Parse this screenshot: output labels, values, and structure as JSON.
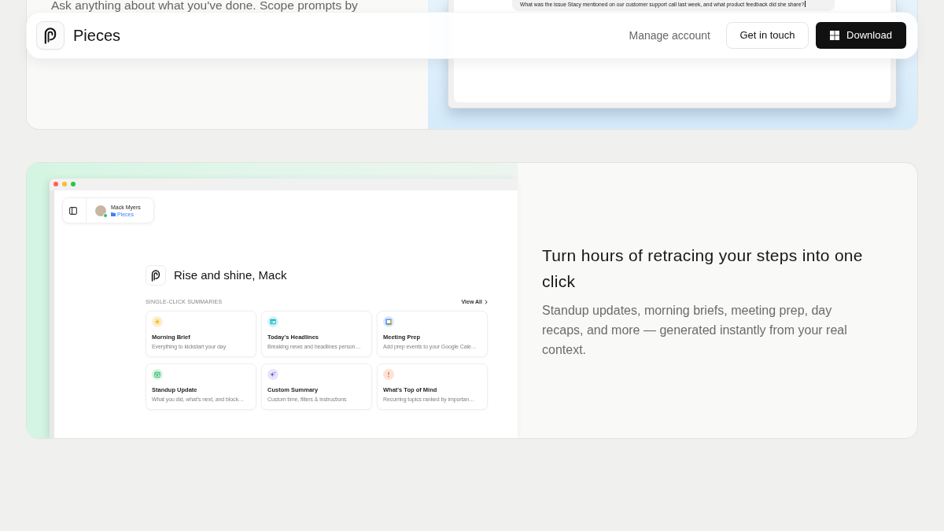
{
  "navbar": {
    "brand": "Pieces",
    "actions": [
      {
        "kind": "link",
        "label": "Manage account"
      },
      {
        "kind": "outline",
        "label": "Get in touch"
      },
      {
        "kind": "download",
        "label": "Download"
      }
    ]
  },
  "features": [
    {
      "kind": "prompt",
      "text": "Ask anything about what you've done. Scope prompts by",
      "preview": {
        "prompt": "What was the issue Stacy mentioned on our customer support call last week, and what product feedback did she share?"
      }
    },
    {
      "kind": "summaries",
      "title": "Turn hours of retracing your steps into one click",
      "text": "Standup updates, morning briefs, meeting prep, day recaps, and more — generated instantly from your real context.",
      "preview": {
        "user": {
          "name": "Mack Myers",
          "workspace": "Pieces"
        },
        "greeting": "Rise and shine, Mack",
        "section_label": "SINGLE-CLICK SUMMARIES",
        "view_all": "View All",
        "summaries": [
          {
            "kind": "sun",
            "title": "Morning Brief",
            "subtitle": "Everything to kickstart your day"
          },
          {
            "kind": "window",
            "title": "Today's Headlines",
            "subtitle": "Breaking news and headlines person…"
          },
          {
            "kind": "schedule",
            "title": "Meeting Prep",
            "subtitle": "Add prep events to your Google Cale…"
          },
          {
            "kind": "calendar",
            "title": "Standup Update",
            "subtitle": "What you did, what's next, and block…"
          },
          {
            "kind": "sparkle",
            "title": "Custom Summary",
            "subtitle": "Custom time, filters & instructions"
          },
          {
            "kind": "alert",
            "title": "What's Top of Mind",
            "subtitle": "Recurring topics ranked by importan…"
          }
        ]
      }
    }
  ]
}
